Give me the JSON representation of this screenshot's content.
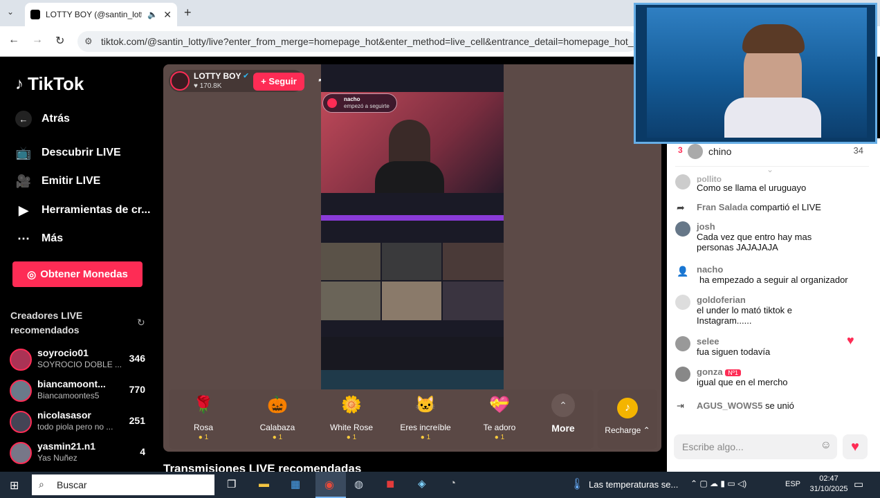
{
  "browser": {
    "tab_title": "LOTTY BOY (@santin_lotty)",
    "url": "tiktok.com/@santin_lotty/live?enter_from_merge=homepage_hot&enter_method=live_cell&entrance_detail=homepage_hot_live_cell"
  },
  "sidebar": {
    "logo": "TikTok",
    "back": "Atrás",
    "nav": [
      "Descubrir LIVE",
      "Emitir LIVE",
      "Herramientas de cr...",
      "Más"
    ],
    "coins_button": "Obtener Monedas",
    "creators_heading": "Creadores LIVE recomendados",
    "creators": [
      {
        "name": "soyrocio01",
        "desc": "SOYROCIO DOBLE ...",
        "count": "346"
      },
      {
        "name": "biancamoont...",
        "desc": "Biancamoontes5",
        "count": "770"
      },
      {
        "name": "nicolasasor",
        "desc": "todo piola pero no ...",
        "count": "251"
      },
      {
        "name": "yasmin21.n1",
        "desc": "Yas Nuñez",
        "count": "4"
      }
    ]
  },
  "stream": {
    "host_name": "LOTTY BOY",
    "host_likes": "170.8K",
    "follow_label": "+ Seguir",
    "overlay_user": "nacho",
    "overlay_text": "empezó a seguirte",
    "recommended_heading": "Transmisiones LIVE recomendadas"
  },
  "gifts": [
    {
      "name": "Rosa",
      "price": "1",
      "icon": "rose"
    },
    {
      "name": "Calabaza",
      "price": "1",
      "icon": "pumpkin"
    },
    {
      "name": "White Rose",
      "price": "1",
      "icon": "white-rose"
    },
    {
      "name": "Eres increíble",
      "price": "1",
      "icon": "cat"
    },
    {
      "name": "Te adoro",
      "price": "1",
      "icon": "heart"
    }
  ],
  "gift_more": "More",
  "recharge": "Recharge",
  "chat": {
    "top_rank": "3",
    "top_user": "chino",
    "top_score": "34",
    "messages": [
      {
        "user": "pollito_",
        "text": "Como se llama el uruguayo"
      },
      {
        "user": "Fran Salada",
        "text": "compartió el LIVE"
      },
      {
        "user": "josh",
        "text": "Cada vez que entro hay mas personas JAJAJAJA"
      },
      {
        "user": "nacho",
        "text": "ha empezado a seguir al organizador"
      },
      {
        "user": "goldoferian",
        "text": "el under lo mató tiktok e Instagram......"
      },
      {
        "user": "selee",
        "text": "fua siguen todavía"
      },
      {
        "user": "gonza",
        "badge": "Nº1",
        "text": "igual que en el mercho"
      },
      {
        "user": "AGUS_WOWS5",
        "text": "se unió"
      }
    ],
    "input_placeholder": "Escribe algo..."
  },
  "taskbar": {
    "search": "Buscar",
    "weather": "Las temperaturas se...",
    "lang": "ESP",
    "time": "02:47",
    "date": "31/10/2025"
  }
}
